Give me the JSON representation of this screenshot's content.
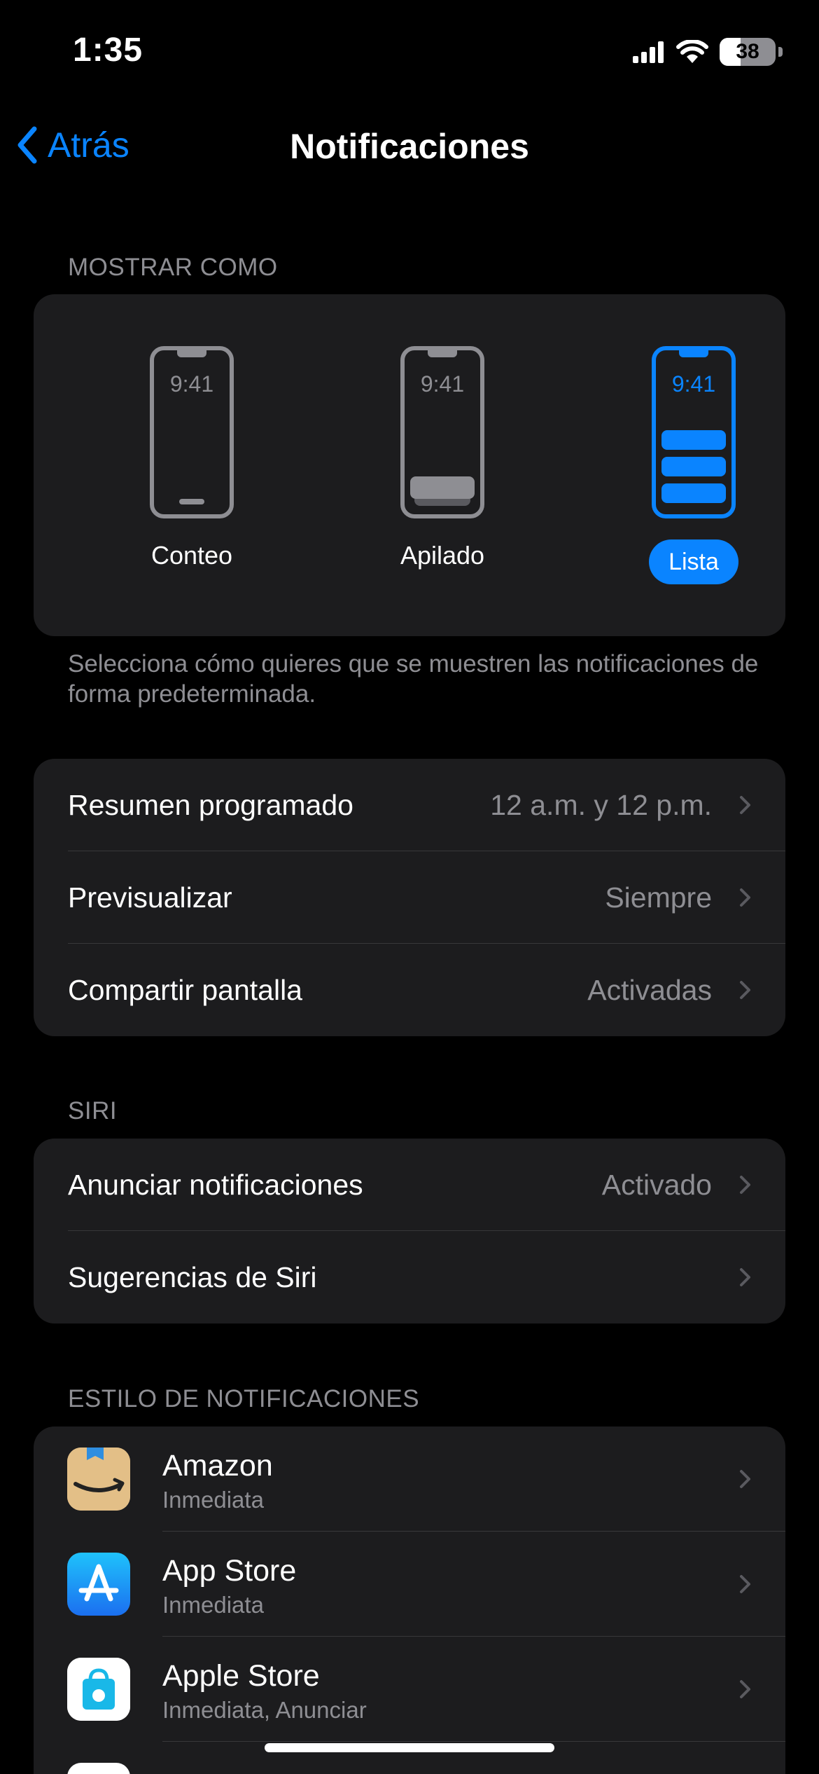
{
  "status_bar": {
    "time": "1:35",
    "battery_level": "38",
    "battery_fraction": 0.38
  },
  "nav": {
    "back_label": "Atrás",
    "title": "Notificaciones"
  },
  "display_as": {
    "header": "MOSTRAR COMO",
    "phone_time": "9:41",
    "options": [
      {
        "label": "Conteo",
        "selected": false
      },
      {
        "label": "Apilado",
        "selected": false
      },
      {
        "label": "Lista",
        "selected": true
      }
    ],
    "footer": "Selecciona cómo quieres que se muestren las notificaciones de forma predeterminada."
  },
  "general_rows": [
    {
      "label": "Resumen programado",
      "value": "12 a.m. y 12 p.m."
    },
    {
      "label": "Previsualizar",
      "value": "Siempre"
    },
    {
      "label": "Compartir pantalla",
      "value": "Activadas"
    }
  ],
  "siri": {
    "header": "SIRI",
    "rows": [
      {
        "label": "Anunciar notificaciones",
        "value": "Activado"
      },
      {
        "label": "Sugerencias de Siri",
        "value": ""
      }
    ]
  },
  "notification_style": {
    "header": "ESTILO DE NOTIFICACIONES",
    "apps": [
      {
        "name": "Amazon",
        "subtitle": "Inmediata",
        "icon": "amazon-app-icon"
      },
      {
        "name": "App Store",
        "subtitle": "Inmediata",
        "icon": "app-store-icon"
      },
      {
        "name": "Apple Store",
        "subtitle": "Inmediata, Anunciar",
        "icon": "apple-store-icon"
      }
    ]
  },
  "colors": {
    "accent": "#0a84ff",
    "background": "#000000",
    "card": "#1c1c1e",
    "secondary_text": "#8e8e93"
  }
}
